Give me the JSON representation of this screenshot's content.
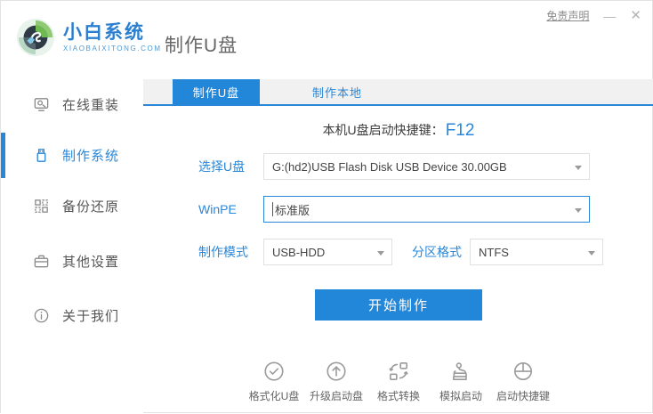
{
  "window": {
    "disclaimer": "免责声明",
    "minimize": "—",
    "close": "✕"
  },
  "header": {
    "brand_name": "小白系统",
    "brand_domain": "XIAOBAIXITONG.COM",
    "page_title": "制作U盘"
  },
  "sidebar": {
    "items": [
      {
        "label": "在线重装",
        "icon": "monitor-reinstall-icon",
        "active": false
      },
      {
        "label": "制作系统",
        "icon": "usb-drive-icon",
        "active": true
      },
      {
        "label": "备份还原",
        "icon": "backup-grid-icon",
        "active": false
      },
      {
        "label": "其他设置",
        "icon": "briefcase-icon",
        "active": false
      },
      {
        "label": "关于我们",
        "icon": "info-icon",
        "active": false
      }
    ]
  },
  "main": {
    "tabs": [
      {
        "label": "制作U盘",
        "active": true
      },
      {
        "label": "制作本地",
        "active": false
      }
    ],
    "hotkey": {
      "label": "本机U盘启动快捷键：",
      "value": "F12"
    },
    "form": {
      "usb_select": {
        "label": "选择U盘",
        "value": "G:(hd2)USB Flash Disk USB Device 30.00GB"
      },
      "winpe_select": {
        "label": "WinPE",
        "value": "标准版"
      },
      "mode_select": {
        "label": "制作模式",
        "value": "USB-HDD"
      },
      "partition_select": {
        "label": "分区格式",
        "value": "NTFS"
      }
    },
    "start_button": "开始制作",
    "tools": [
      {
        "label": "格式化U盘",
        "icon": "format-usb-icon"
      },
      {
        "label": "升级启动盘",
        "icon": "upgrade-boot-icon"
      },
      {
        "label": "格式转换",
        "icon": "format-convert-icon"
      },
      {
        "label": "模拟启动",
        "icon": "simulate-boot-icon"
      },
      {
        "label": "启动快捷键",
        "icon": "boot-hotkey-icon"
      }
    ]
  },
  "colors": {
    "accent": "#2a87d8",
    "tab_active_bg": "#2286d9",
    "tabbar_bg": "#f1f1f1",
    "text_dark": "#555555",
    "muted": "#999999"
  }
}
